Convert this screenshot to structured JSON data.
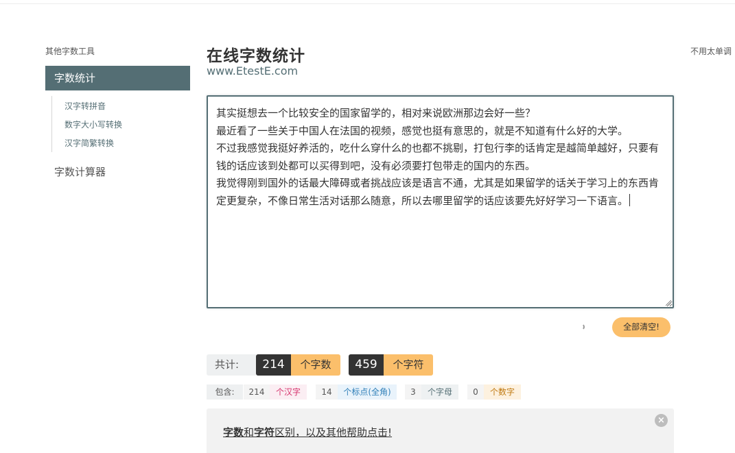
{
  "sidebar": {
    "heading": "其他字数工具",
    "active_item": "字数统计",
    "sub_items": [
      "汉字转拼音",
      "数字大小写转换",
      "汉字简繁转换"
    ],
    "second_item": "字数计算器"
  },
  "header": {
    "title": "在线字数统计",
    "subtitle": "www.EtestE.com"
  },
  "right_link": "不用太单调",
  "editor": {
    "text": "其实挺想去一个比较安全的国家留学的，相对来说欧洲那边会好一些？\n最近看了一些关于中国人在法国的视频，感觉也挺有意思的，就是不知道有什么好的大学。\n不过我感觉我挺好养活的，吃什么穿什么的也都不挑剔，打包行李的话肯定是越简单越好，只要有钱的话应该到处都可以买得到吧，没有必须要打包带走的国内的东西。\n我觉得刚到国外的话最大障碍或者挑战应该是语言不通，尤其是如果留学的话关于学习上的东西肯定更复杂，不像日常生活对话那么随意，所以去哪里留学的话应该要先好好学习一下语言。"
  },
  "actions": {
    "clear_label": "全部清空!"
  },
  "totals": {
    "label": "共计:",
    "chars_count": "214",
    "chars_unit": "个字数",
    "symbols_count": "459",
    "symbols_unit": "个字符"
  },
  "breakdown": {
    "label": "包含:",
    "items": [
      {
        "count": "214",
        "unit": "个汉字",
        "color": "#d6336c",
        "bg": "#fbeef3"
      },
      {
        "count": "14",
        "unit": "个标点(全角)",
        "color": "#2f7fb8",
        "bg": "#e9f3fb"
      },
      {
        "count": "3",
        "unit": "个字母",
        "color": "#546e74",
        "bg": "#eef1f2"
      },
      {
        "count": "0",
        "unit": "个数字",
        "color": "#c07a12",
        "bg": "#fdf1df"
      }
    ]
  },
  "help": {
    "part1": "字数",
    "part2": "和",
    "part3": "字符",
    "part4": "区别，以及其他帮助点击!"
  },
  "colors": {
    "accent": "#546e74",
    "highlight": "#fbbf6b",
    "dark": "#333333"
  }
}
